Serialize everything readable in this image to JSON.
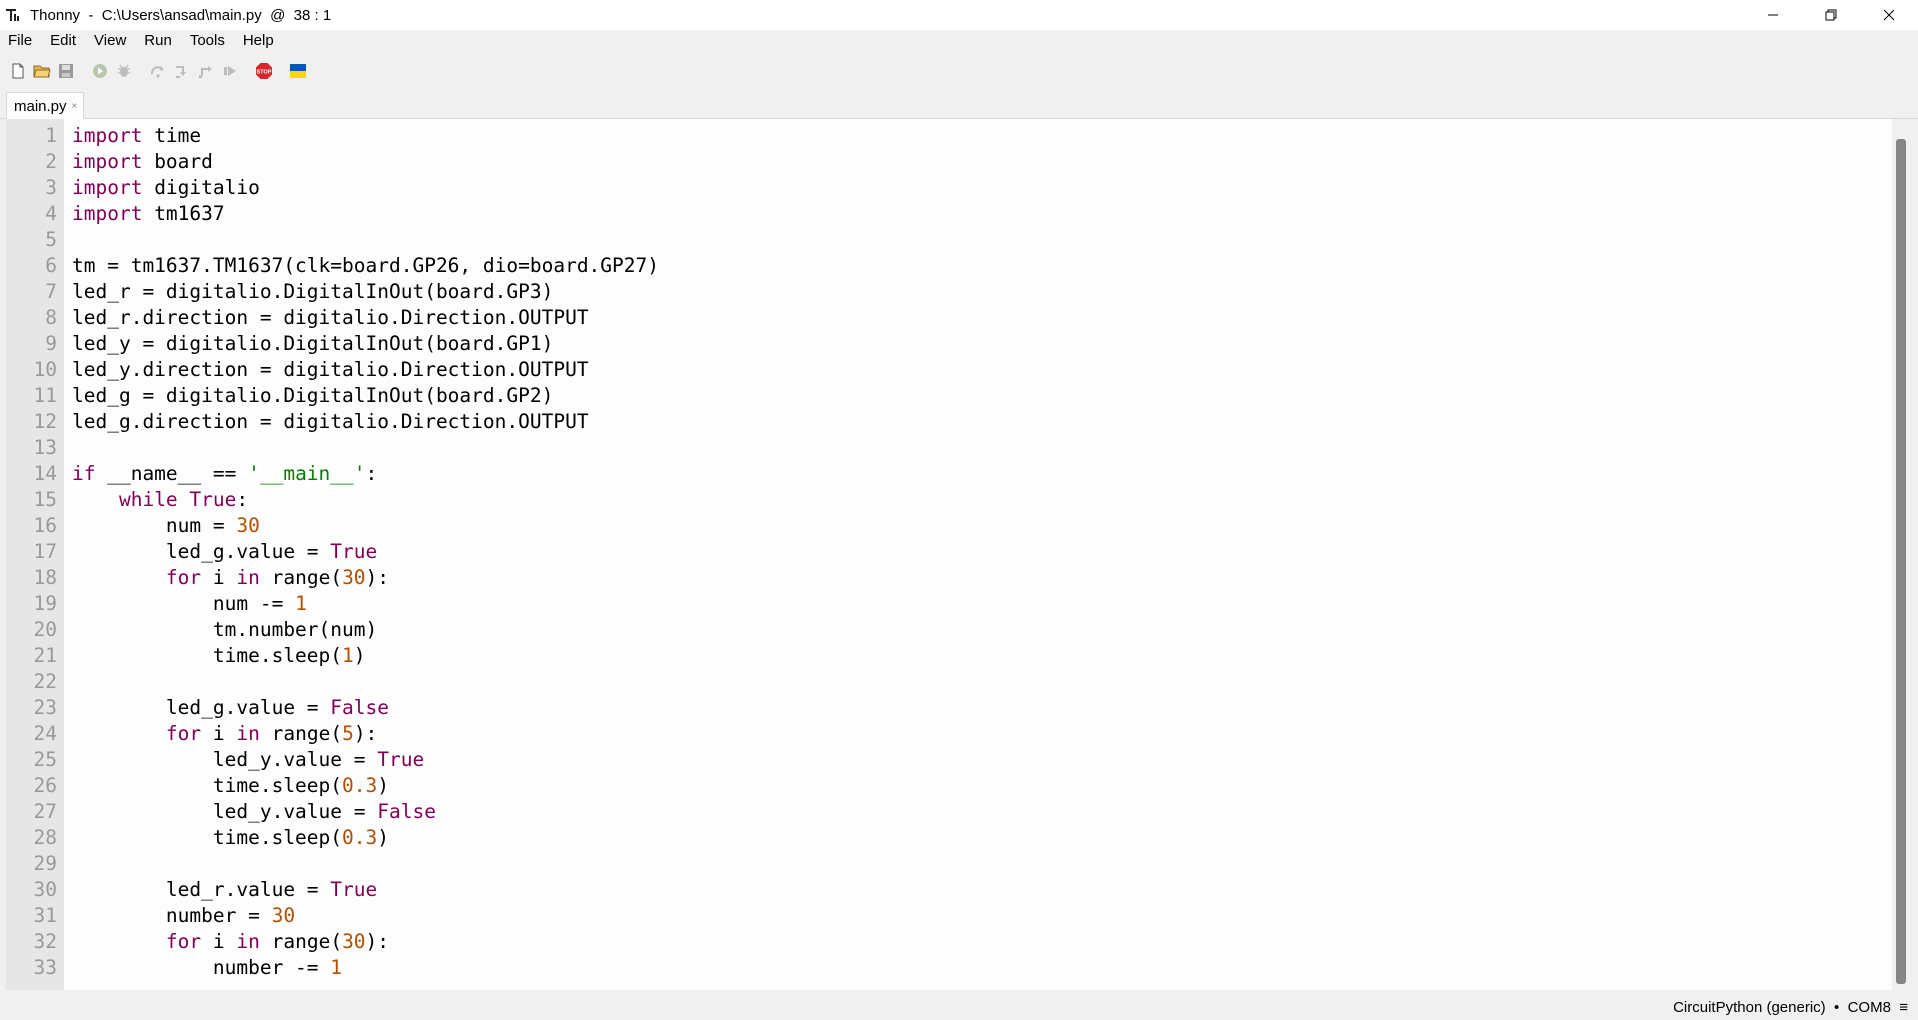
{
  "window": {
    "title": "Thonny  -  C:\\Users\\ansad\\main.py  @  38 : 1",
    "app_icon": "thonny-logo-icon",
    "controls": [
      "minimize-icon",
      "restore-icon",
      "close-icon"
    ]
  },
  "menu": {
    "items": [
      "File",
      "Edit",
      "View",
      "Run",
      "Tools",
      "Help"
    ]
  },
  "toolbar": {
    "buttons": [
      {
        "name": "new-file-icon"
      },
      {
        "name": "open-folder-icon"
      },
      {
        "name": "save-icon"
      },
      {
        "name": "run-icon"
      },
      {
        "name": "debug-icon"
      },
      {
        "name": "step-over-icon"
      },
      {
        "name": "step-into-icon"
      },
      {
        "name": "step-out-icon"
      },
      {
        "name": "resume-icon"
      },
      {
        "name": "stop-icon",
        "label": "STOP"
      },
      {
        "name": "ukraine-flag-icon"
      }
    ]
  },
  "tabs": [
    {
      "label": "main.py",
      "close": "×"
    }
  ],
  "editor": {
    "colors": {
      "keyword": "#7f0055",
      "number": "#b05000",
      "string": "#008000",
      "default": "#000000"
    },
    "lines": [
      {
        "n": "1",
        "tokens": [
          {
            "t": "import",
            "k": "keyword"
          },
          {
            "t": " time"
          }
        ]
      },
      {
        "n": "2",
        "tokens": [
          {
            "t": "import",
            "k": "keyword"
          },
          {
            "t": " board"
          }
        ]
      },
      {
        "n": "3",
        "tokens": [
          {
            "t": "import",
            "k": "keyword"
          },
          {
            "t": " digitalio"
          }
        ]
      },
      {
        "n": "4",
        "tokens": [
          {
            "t": "import",
            "k": "keyword"
          },
          {
            "t": " tm1637"
          }
        ]
      },
      {
        "n": "5",
        "tokens": []
      },
      {
        "n": "6",
        "tokens": [
          {
            "t": "tm = tm1637.TM1637(clk=board.GP26, dio=board.GP27)"
          }
        ]
      },
      {
        "n": "7",
        "tokens": [
          {
            "t": "led_r = digitalio.DigitalInOut(board.GP3)"
          }
        ]
      },
      {
        "n": "8",
        "tokens": [
          {
            "t": "led_r.direction = digitalio.Direction.OUTPUT"
          }
        ]
      },
      {
        "n": "9",
        "tokens": [
          {
            "t": "led_y = digitalio.DigitalInOut(board.GP1)"
          }
        ]
      },
      {
        "n": "10",
        "tokens": [
          {
            "t": "led_y.direction = digitalio.Direction.OUTPUT"
          }
        ]
      },
      {
        "n": "11",
        "tokens": [
          {
            "t": "led_g = digitalio.DigitalInOut(board.GP2)"
          }
        ]
      },
      {
        "n": "12",
        "tokens": [
          {
            "t": "led_g.direction = digitalio.Direction.OUTPUT"
          }
        ]
      },
      {
        "n": "13",
        "tokens": []
      },
      {
        "n": "14",
        "tokens": [
          {
            "t": "if",
            "k": "keyword"
          },
          {
            "t": " __name__ == "
          },
          {
            "t": "'__main__'",
            "k": "string"
          },
          {
            "t": ":"
          }
        ]
      },
      {
        "n": "15",
        "tokens": [
          {
            "t": "    "
          },
          {
            "t": "while",
            "k": "keyword"
          },
          {
            "t": " "
          },
          {
            "t": "True",
            "k": "keyword"
          },
          {
            "t": ":"
          }
        ]
      },
      {
        "n": "16",
        "tokens": [
          {
            "t": "        num = "
          },
          {
            "t": "30",
            "k": "number"
          }
        ]
      },
      {
        "n": "17",
        "tokens": [
          {
            "t": "        led_g.value = "
          },
          {
            "t": "True",
            "k": "keyword"
          }
        ]
      },
      {
        "n": "18",
        "tokens": [
          {
            "t": "        "
          },
          {
            "t": "for",
            "k": "keyword"
          },
          {
            "t": " i "
          },
          {
            "t": "in",
            "k": "keyword"
          },
          {
            "t": " range("
          },
          {
            "t": "30",
            "k": "number"
          },
          {
            "t": "):"
          }
        ]
      },
      {
        "n": "19",
        "tokens": [
          {
            "t": "            num -= "
          },
          {
            "t": "1",
            "k": "number"
          }
        ]
      },
      {
        "n": "20",
        "tokens": [
          {
            "t": "            tm.number(num)"
          }
        ]
      },
      {
        "n": "21",
        "tokens": [
          {
            "t": "            time.sleep("
          },
          {
            "t": "1",
            "k": "number"
          },
          {
            "t": ")"
          }
        ]
      },
      {
        "n": "22",
        "tokens": []
      },
      {
        "n": "23",
        "tokens": [
          {
            "t": "        led_g.value = "
          },
          {
            "t": "False",
            "k": "keyword"
          }
        ]
      },
      {
        "n": "24",
        "tokens": [
          {
            "t": "        "
          },
          {
            "t": "for",
            "k": "keyword"
          },
          {
            "t": " i "
          },
          {
            "t": "in",
            "k": "keyword"
          },
          {
            "t": " range("
          },
          {
            "t": "5",
            "k": "number"
          },
          {
            "t": "):"
          }
        ]
      },
      {
        "n": "25",
        "tokens": [
          {
            "t": "            led_y.value = "
          },
          {
            "t": "True",
            "k": "keyword"
          }
        ]
      },
      {
        "n": "26",
        "tokens": [
          {
            "t": "            time.sleep("
          },
          {
            "t": "0.3",
            "k": "number"
          },
          {
            "t": ")"
          }
        ]
      },
      {
        "n": "27",
        "tokens": [
          {
            "t": "            led_y.value = "
          },
          {
            "t": "False",
            "k": "keyword"
          }
        ]
      },
      {
        "n": "28",
        "tokens": [
          {
            "t": "            time.sleep("
          },
          {
            "t": "0.3",
            "k": "number"
          },
          {
            "t": ")"
          }
        ]
      },
      {
        "n": "29",
        "tokens": []
      },
      {
        "n": "30",
        "tokens": [
          {
            "t": "        led_r.value = "
          },
          {
            "t": "True",
            "k": "keyword"
          }
        ]
      },
      {
        "n": "31",
        "tokens": [
          {
            "t": "        number = "
          },
          {
            "t": "30",
            "k": "number"
          }
        ]
      },
      {
        "n": "32",
        "tokens": [
          {
            "t": "        "
          },
          {
            "t": "for",
            "k": "keyword"
          },
          {
            "t": " i "
          },
          {
            "t": "in",
            "k": "keyword"
          },
          {
            "t": " range("
          },
          {
            "t": "30",
            "k": "number"
          },
          {
            "t": "):"
          }
        ]
      },
      {
        "n": "33",
        "tokens": [
          {
            "t": "            number -= "
          },
          {
            "t": "1",
            "k": "number"
          }
        ]
      }
    ]
  },
  "status": {
    "interpreter": "CircuitPython (generic)  •  COM8  ≡"
  }
}
